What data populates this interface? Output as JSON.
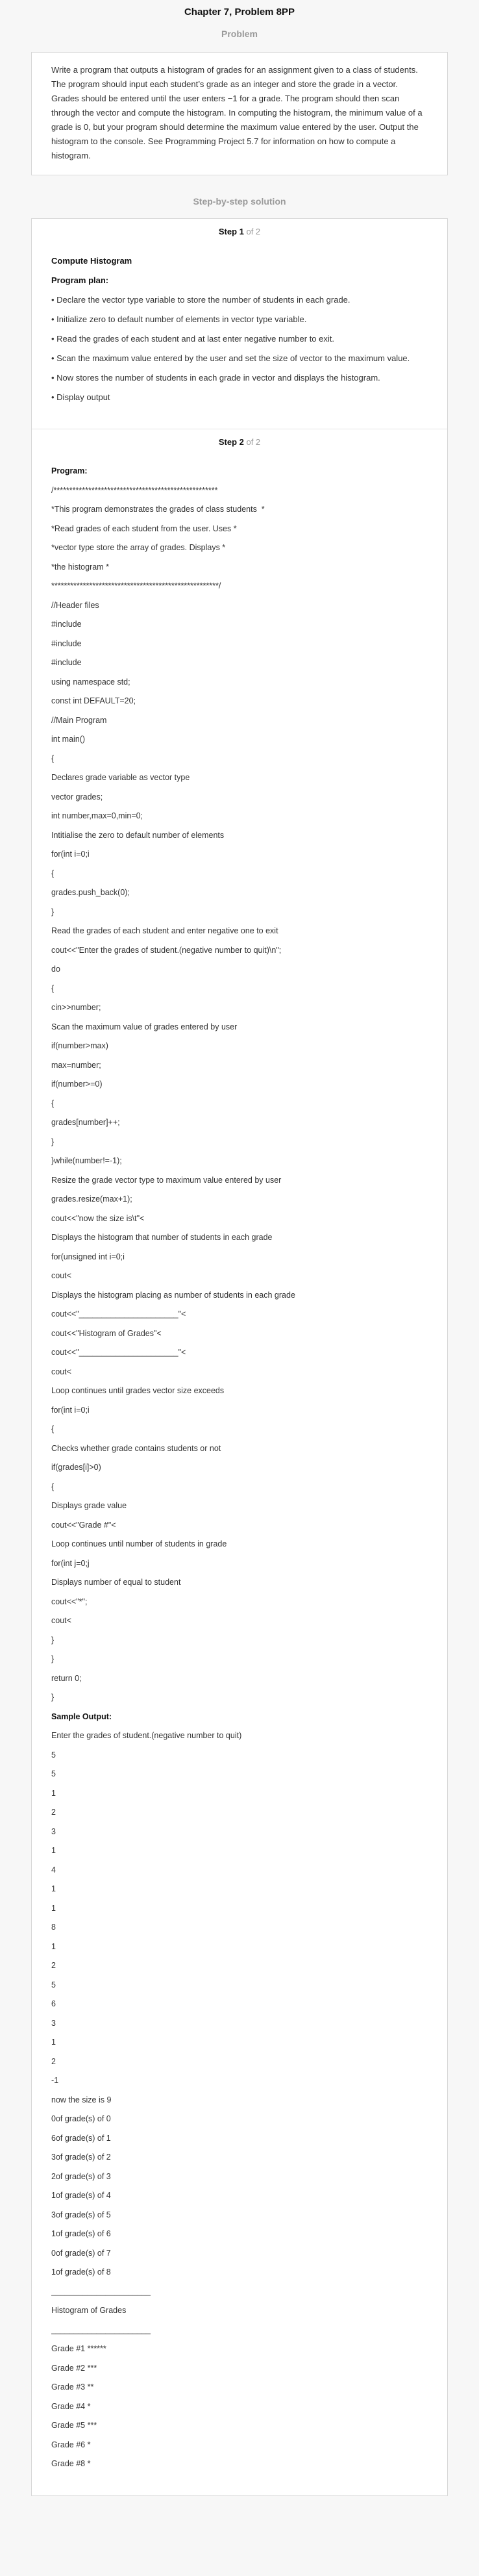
{
  "header": {
    "title": "Chapter 7, Problem 8PP"
  },
  "problem": {
    "heading": "Problem",
    "text": "Write a program that outputs a histogram of grades for an assignment given to a class of students. The program should input each student’s grade as an integer and store the grade in a vector. Grades should be entered until the user enters −1 for a grade. The program should then scan through the vector and compute the histogram. In computing the histogram, the minimum value of a grade is 0, but your program should determine the maximum value entered by the user. Output the histogram to the console. See Programming Project 5.7 for information on how to compute a histogram."
  },
  "solution": {
    "heading": "Step-by-step solution",
    "step1": {
      "label_bold": "Step 1",
      "label_of": " of 2",
      "title": "Compute Histogram",
      "plan_title": "Program plan:",
      "items": [
        "• Declare the vector type variable to store the number of students in each grade.",
        "• Initialize zero to default number of elements in vector type variable.",
        "• Read the grades of each student and at last enter negative number to exit.",
        "• Scan the maximum value entered by the user and set the size of vector to the maximum value.",
        "• Now stores the number of students in each grade in vector and displays the histogram.",
        "• Display output"
      ]
    },
    "step2": {
      "label_bold": "Step 2",
      "label_of": " of 2",
      "lines": [
        {
          "t": "Program:",
          "b": true
        },
        {
          "t": "/****************************************************"
        },
        {
          "t": "*This program demonstrates the grades of class students  *"
        },
        {
          "t": "*Read grades of each student from the user. Uses *"
        },
        {
          "t": "*vector type store the array of grades. Displays *"
        },
        {
          "t": "*the histogram *"
        },
        {
          "t": "*****************************************************/"
        },
        {
          "t": "//Header files"
        },
        {
          "t": "#include"
        },
        {
          "t": "#include"
        },
        {
          "t": "#include"
        },
        {
          "t": "using namespace std;"
        },
        {
          "t": "const int DEFAULT=20;"
        },
        {
          "t": "//Main Program"
        },
        {
          "t": "int main()"
        },
        {
          "t": "{"
        },
        {
          "t": "Declares grade variable as vector type"
        },
        {
          "t": "vector grades;"
        },
        {
          "t": "int number,max=0,min=0;"
        },
        {
          "t": "Intitialise the zero to default number of elements"
        },
        {
          "t": "for(int i=0;i"
        },
        {
          "t": "{"
        },
        {
          "t": "grades.push_back(0);"
        },
        {
          "t": "}"
        },
        {
          "t": "Read the grades of each student and enter negative one to exit"
        },
        {
          "t": "cout<<\"Enter the grades of student.(negative number to quit)\\n\";"
        },
        {
          "t": "do"
        },
        {
          "t": "{"
        },
        {
          "t": "cin>>number;"
        },
        {
          "t": "Scan the maximum value of grades entered by user"
        },
        {
          "t": "if(number>max)"
        },
        {
          "t": "max=number;"
        },
        {
          "t": "if(number>=0)"
        },
        {
          "t": "{"
        },
        {
          "t": "grades[number]++;"
        },
        {
          "t": "}"
        },
        {
          "t": "}while(number!=-1);"
        },
        {
          "t": "Resize the grade vector type to maximum value entered by user"
        },
        {
          "t": "grades.resize(max+1);"
        },
        {
          "t": "cout<<\"now the size is\\t\"<"
        },
        {
          "t": "Displays the histogram that number of students in each grade"
        },
        {
          "t": "for(unsigned int i=0;i"
        },
        {
          "t": "cout<"
        },
        {
          "t": "Displays the histogram placing as number of students in each grade"
        },
        {
          "t": "cout<<\"______________________\"<"
        },
        {
          "t": "cout<<\"Histogram of Grades\"<"
        },
        {
          "t": "cout<<\"______________________\"<"
        },
        {
          "t": "cout<"
        },
        {
          "t": "Loop continues until grades vector size exceeds"
        },
        {
          "t": "for(int i=0;i"
        },
        {
          "t": "{"
        },
        {
          "t": "Checks whether grade contains students or not"
        },
        {
          "t": "if(grades[i]>0)"
        },
        {
          "t": "{"
        },
        {
          "t": "Displays grade value"
        },
        {
          "t": "cout<<\"Grade #\"<"
        },
        {
          "t": "Loop continues until number of students in grade"
        },
        {
          "t": "for(int j=0;j"
        },
        {
          "t": "Displays number of equal to student"
        },
        {
          "t": "cout<<\"*\";"
        },
        {
          "t": "cout<"
        },
        {
          "t": "}"
        },
        {
          "t": "}"
        },
        {
          "t": "return 0;"
        },
        {
          "t": "}"
        },
        {
          "t": "Sample Output:",
          "b": true
        },
        {
          "t": "Enter the grades of student.(negative number to quit)"
        },
        {
          "t": "5"
        },
        {
          "t": "5"
        },
        {
          "t": "1"
        },
        {
          "t": "2"
        },
        {
          "t": "3"
        },
        {
          "t": "1"
        },
        {
          "t": "4"
        },
        {
          "t": "1"
        },
        {
          "t": "1"
        },
        {
          "t": "8"
        },
        {
          "t": "1"
        },
        {
          "t": "2"
        },
        {
          "t": "5"
        },
        {
          "t": "6"
        },
        {
          "t": "3"
        },
        {
          "t": "1"
        },
        {
          "t": "2"
        },
        {
          "t": "-1"
        },
        {
          "t": "now the size is 9"
        },
        {
          "t": "0of grade(s) of 0"
        },
        {
          "t": "6of grade(s) of 1"
        },
        {
          "t": "3of grade(s) of 2"
        },
        {
          "t": "2of grade(s) of 3"
        },
        {
          "t": "1of grade(s) of 4"
        },
        {
          "t": "3of grade(s) of 5"
        },
        {
          "t": "1of grade(s) of 6"
        },
        {
          "t": "0of grade(s) of 7"
        },
        {
          "t": "1of grade(s) of 8"
        },
        {
          "t": "______________________"
        },
        {
          "t": "Histogram of Grades"
        },
        {
          "t": "______________________"
        },
        {
          "t": "Grade #1 ******"
        },
        {
          "t": "Grade #2 ***"
        },
        {
          "t": "Grade #3 **"
        },
        {
          "t": "Grade #4 *"
        },
        {
          "t": "Grade #5 ***"
        },
        {
          "t": "Grade #6 *"
        },
        {
          "t": "Grade #8 *"
        }
      ]
    }
  }
}
